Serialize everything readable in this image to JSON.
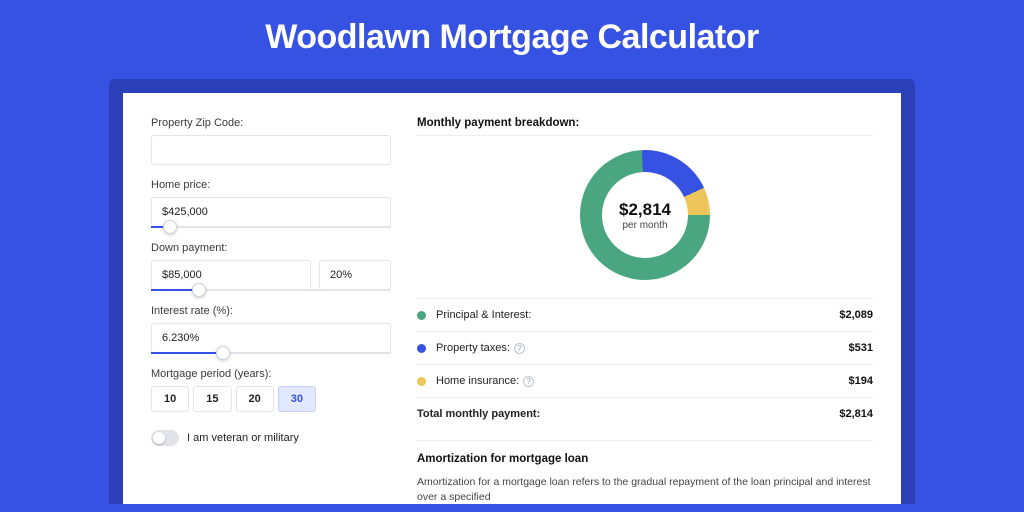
{
  "title": "Woodlawn Mortgage Calculator",
  "colors": {
    "principal_interest": "#4aa581",
    "property_taxes": "#3652e3",
    "home_insurance": "#eec55a"
  },
  "form": {
    "zip": {
      "label": "Property Zip Code:",
      "value": ""
    },
    "home_price": {
      "label": "Home price:",
      "value": "$425,000",
      "slider_pct": 8
    },
    "down_payment": {
      "label": "Down payment:",
      "amount": "$85,000",
      "pct": "20%",
      "slider_pct": 20
    },
    "interest": {
      "label": "Interest rate (%):",
      "value": "6.230%",
      "slider_pct": 30
    },
    "period": {
      "label": "Mortgage period (years):",
      "options": [
        "10",
        "15",
        "20",
        "30"
      ],
      "active": "30"
    },
    "veteran": {
      "label": "I am veteran or military",
      "checked": false
    }
  },
  "breakdown": {
    "heading": "Monthly payment breakdown:",
    "center_value": "$2,814",
    "center_sub": "per month",
    "items": [
      {
        "key": "pi",
        "label": "Principal & Interest:",
        "value": "$2,089",
        "has_info": false
      },
      {
        "key": "tax",
        "label": "Property taxes:",
        "value": "$531",
        "has_info": true
      },
      {
        "key": "ins",
        "label": "Home insurance:",
        "value": "$194",
        "has_info": true
      }
    ],
    "total_label": "Total monthly payment:",
    "total_value": "$2,814"
  },
  "chart_data": {
    "type": "pie",
    "title": "Monthly payment breakdown",
    "series": [
      {
        "name": "Principal & Interest",
        "value": 2089
      },
      {
        "name": "Property taxes",
        "value": 531
      },
      {
        "name": "Home insurance",
        "value": 194
      }
    ],
    "total": 2814,
    "unit": "USD",
    "center_label": "$2,814 per month"
  },
  "amortization": {
    "heading": "Amortization for mortgage loan",
    "text": "Amortization for a mortgage loan refers to the gradual repayment of the loan principal and interest over a specified"
  }
}
